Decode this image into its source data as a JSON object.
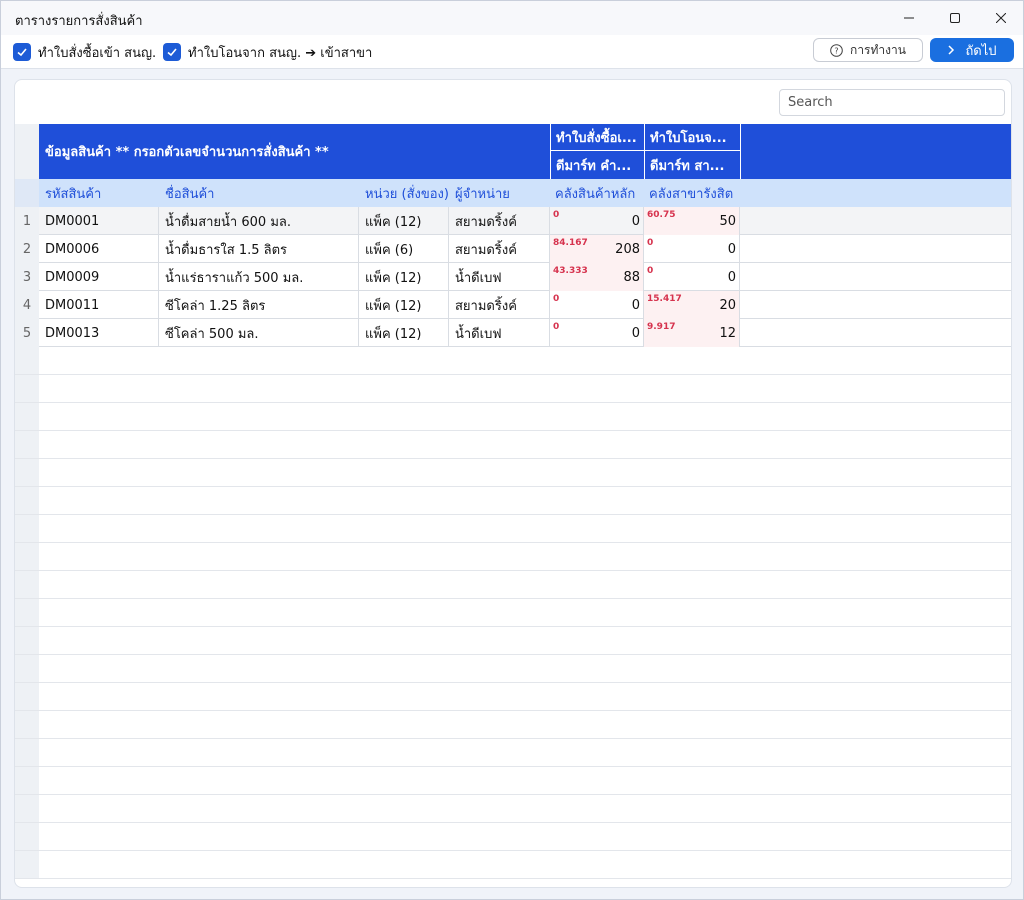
{
  "window": {
    "title": "ตารางรายการสั่งสินค้า"
  },
  "toolbar": {
    "check_po": "ทำใบสั่งซื้อเข้า สนญ.",
    "check_transfer": "ทำใบโอนจาก สนญ. ➔ เข้าสาขา",
    "howto_label": "การทำงาน",
    "next_label": "ถัดไป"
  },
  "search": {
    "placeholder": "Search"
  },
  "table": {
    "group_header": "ข้อมูลสินค้า   ** กรอกตัวเลขจำนวนการสั่งสินค้า **",
    "group_po": "ทำใบสั่งซื้อเ...",
    "group_transfer": "ทำใบโอนจ...",
    "sub_po": "ดีมาร์ท คํา...",
    "sub_transfer": "ดีมาร์ท สา...",
    "columns": {
      "code": "รหัสสินค้า",
      "name": "ชื่อสินค้า",
      "unit": "หน่วย (สั่งของ)",
      "vendor": "ผู้จำหน่าย",
      "main_wh": "คลังสินค้าหลัก",
      "branch_wh": "คลังสาขารังสิต"
    },
    "rows": [
      {
        "no": "1",
        "code": "DM0001",
        "name": "น้ำดื่มสายน้ำ 600 มล.",
        "unit": "แพ็ค (12)",
        "vendor": "สยามดริ้งค์",
        "main_hint": "0",
        "main_qty": "0",
        "branch_hint": "60.75",
        "branch_qty": "50"
      },
      {
        "no": "2",
        "code": "DM0006",
        "name": "น้ำดื่มธารใส 1.5 ลิตร",
        "unit": "แพ็ค (6)",
        "vendor": "สยามดริ้งค์",
        "main_hint": "84.167",
        "main_qty": "208",
        "branch_hint": "0",
        "branch_qty": "0"
      },
      {
        "no": "3",
        "code": "DM0009",
        "name": "น้ำแร่ธาราแก้ว 500 มล.",
        "unit": "แพ็ค (12)",
        "vendor": "น้ำดีเบฟ",
        "main_hint": "43.333",
        "main_qty": "88",
        "branch_hint": "0",
        "branch_qty": "0"
      },
      {
        "no": "4",
        "code": "DM0011",
        "name": "ซีโคล่า 1.25 ลิตร",
        "unit": "แพ็ค (12)",
        "vendor": "สยามดริ้งค์",
        "main_hint": "0",
        "main_qty": "0",
        "branch_hint": "15.417",
        "branch_qty": "20"
      },
      {
        "no": "5",
        "code": "DM0013",
        "name": "ซีโคล่า 500 มล.",
        "unit": "แพ็ค (12)",
        "vendor": "น้ำดีเบฟ",
        "main_hint": "0",
        "main_qty": "0",
        "branch_hint": "9.917",
        "branch_qty": "12"
      }
    ]
  },
  "colors": {
    "header_blue": "#1f4fd9",
    "subheader_bg": "#cfe2fb",
    "hint_red": "#d6334e",
    "primary_button": "#1a6fe0"
  }
}
